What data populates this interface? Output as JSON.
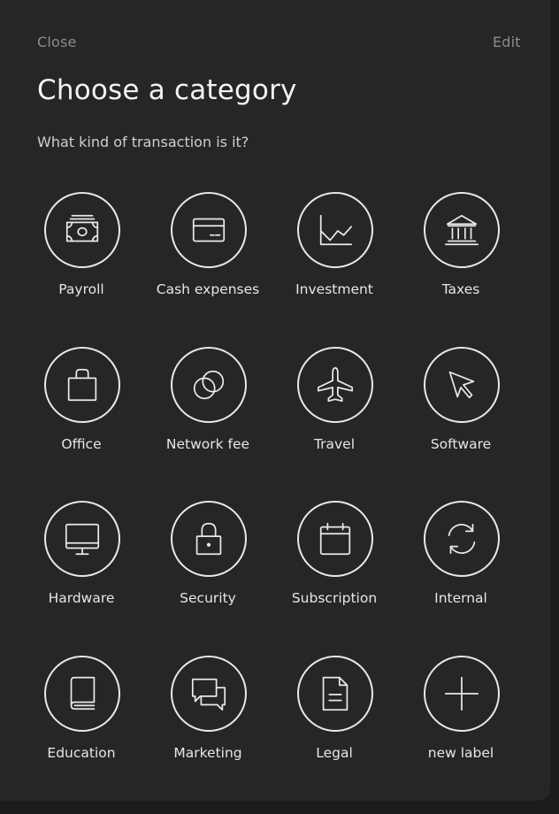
{
  "header": {
    "close_label": "Close",
    "edit_label": "Edit",
    "title": "Choose a category",
    "subtitle": "What kind of transaction is it?"
  },
  "categories": [
    {
      "label": "Payroll",
      "icon": "banknote-icon"
    },
    {
      "label": "Cash expenses",
      "icon": "credit-card-icon"
    },
    {
      "label": "Investment",
      "icon": "line-chart-icon"
    },
    {
      "label": "Taxes",
      "icon": "bank-building-icon"
    },
    {
      "label": "Office",
      "icon": "shopping-bag-icon"
    },
    {
      "label": "Network fee",
      "icon": "coins-icon"
    },
    {
      "label": "Travel",
      "icon": "airplane-icon"
    },
    {
      "label": "Software",
      "icon": "cursor-arrow-icon"
    },
    {
      "label": "Hardware",
      "icon": "monitor-icon"
    },
    {
      "label": "Security",
      "icon": "padlock-icon"
    },
    {
      "label": "Subscription",
      "icon": "calendar-icon"
    },
    {
      "label": "Internal",
      "icon": "refresh-icon"
    },
    {
      "label": "Education",
      "icon": "book-icon"
    },
    {
      "label": "Marketing",
      "icon": "chat-bubbles-icon"
    },
    {
      "label": "Legal",
      "icon": "document-icon"
    },
    {
      "label": "new label",
      "icon": "plus-icon"
    }
  ],
  "colors": {
    "background": "#252626",
    "outer_background": "#1b1c1c",
    "title": "#f2f2f2",
    "muted": "#8c8c8c",
    "icon_stroke": "#e9e9e9"
  }
}
